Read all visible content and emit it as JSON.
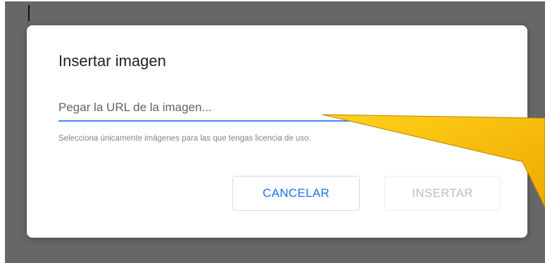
{
  "dialog": {
    "title": "Insertar imagen",
    "url_input": {
      "value": "",
      "placeholder": "Pegar la URL de la imagen..."
    },
    "helper_text": "Selecciona únicamente imágenes para las que tengas licencia de uso.",
    "cancel_label": "CANCELAR",
    "insert_label": "INSERTAR"
  },
  "colors": {
    "accent": "#4285f4",
    "cancel_text": "#1a73e8",
    "disabled_text": "#bdbdbd",
    "overlay": "#676767",
    "annotation_arrow": "#f5b800"
  },
  "icons": {
    "annotation": "pointer-arrow-icon"
  }
}
